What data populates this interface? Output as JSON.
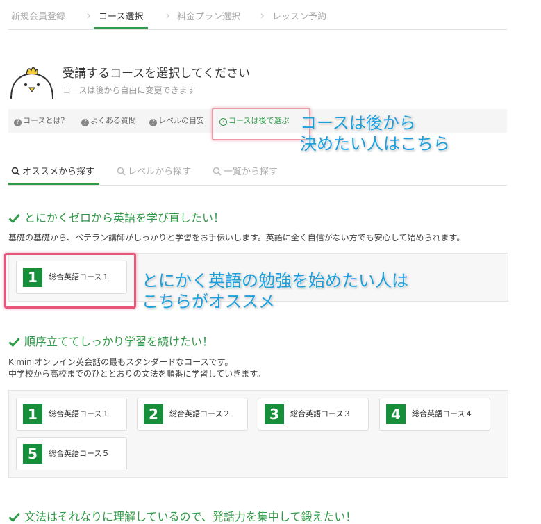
{
  "steps": [
    {
      "label": "新規会員登録"
    },
    {
      "label": "コース選択"
    },
    {
      "label": "料金プラン選択"
    },
    {
      "label": "レッスン予約"
    }
  ],
  "header": {
    "title": "受講するコースを選択してください",
    "subtitle": "コースは後から自由に変更できます"
  },
  "help_links": [
    {
      "label": "コースとは？"
    },
    {
      "label": "よくある質問"
    },
    {
      "label": "レベルの目安"
    },
    {
      "label": "コースは後で選ぶ"
    }
  ],
  "annotations": {
    "later": [
      "コースは後から",
      "決めたい人はこちら"
    ],
    "recommend": [
      "とにかく英語の勉強を始めたい人は",
      "こちらがオススメ"
    ]
  },
  "tabs": [
    {
      "label": "オススメから探す"
    },
    {
      "label": "レベルから探す"
    },
    {
      "label": "一覧から探す"
    }
  ],
  "sections": [
    {
      "title": "とにかくゼロから英語を学び直したい！",
      "desc": [
        "基礎の基礎から、ベテラン講師がしっかりと学習をお手伝いします。英語に全く自信がない方でも安心して始められます。"
      ],
      "courses": [
        {
          "num": "1",
          "name": "総合英語コース１"
        }
      ]
    },
    {
      "title": "順序立ててしっかり学習を続けたい！",
      "desc": [
        "Kiminiオンライン英会話の最もスタンダードなコースです。",
        "中学校から高校までのひととおりの文法を順番に学習していきます。"
      ],
      "courses": [
        {
          "num": "1",
          "name": "総合英語コース１"
        },
        {
          "num": "2",
          "name": "総合英語コース２"
        },
        {
          "num": "3",
          "name": "総合英語コース３"
        },
        {
          "num": "4",
          "name": "総合英語コース４"
        },
        {
          "num": "5",
          "name": "総合英語コース５"
        }
      ]
    },
    {
      "title": "文法はそれなりに理解しているので、発話力を集中して鍛えたい！"
    }
  ],
  "colors": {
    "accent": "#2f9a47",
    "course_badge": "#178f3a",
    "annotation": "#1d9fdb",
    "highlight": "#e8567a"
  }
}
